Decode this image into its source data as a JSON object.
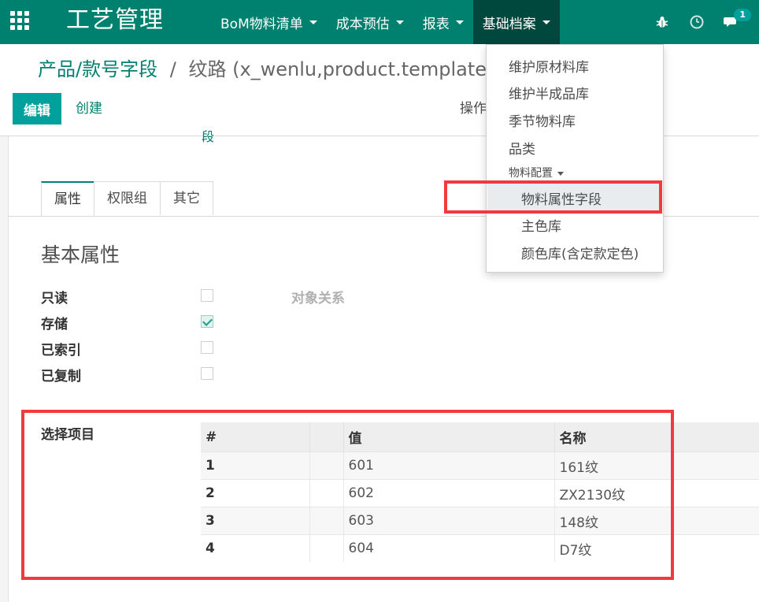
{
  "navbar": {
    "brand": "工艺管理",
    "menus": [
      {
        "label": "BoM物料清单"
      },
      {
        "label": "成本预估"
      },
      {
        "label": "报表"
      },
      {
        "label": "基础档案"
      }
    ],
    "chat_badge": "1",
    "colors": {
      "navbar": "#00806f",
      "active_menu": "#00473e",
      "accent": "#00a09d",
      "annotation": "#f03a40"
    }
  },
  "breadcrumb": {
    "parent": "产品/款号字段",
    "separator": "/",
    "current": "纹路 (x_wenlu,product.template)"
  },
  "toolbar": {
    "edit_label": "编辑",
    "create_label": "创建",
    "actions_label": "操作"
  },
  "form": {
    "cut_text": "段",
    "tabs": [
      {
        "label": "属性",
        "active": true
      },
      {
        "label": "权限组",
        "active": false
      },
      {
        "label": "其它",
        "active": false
      }
    ],
    "group_title": "基本属性",
    "fields": [
      {
        "label": "只读",
        "checked": false
      },
      {
        "label": "存储",
        "checked": true
      },
      {
        "label": "已索引",
        "checked": false
      },
      {
        "label": "已复制",
        "checked": false
      }
    ],
    "relation_label": "对象关系",
    "selection": {
      "label": "选择项目",
      "headers": [
        "#",
        "",
        "值",
        "名称"
      ],
      "rows": [
        [
          "1",
          "",
          "601",
          "161纹"
        ],
        [
          "2",
          "",
          "602",
          "ZX2130纹"
        ],
        [
          "3",
          "",
          "603",
          "148纹"
        ],
        [
          "4",
          "",
          "604",
          "D7纹"
        ]
      ]
    }
  },
  "dropdown": {
    "items": [
      {
        "label": "维护原材料库"
      },
      {
        "label": "维护半成品库"
      },
      {
        "label": "季节物料库"
      },
      {
        "label": "品类"
      }
    ],
    "section_header": "物料配置",
    "sub_items": [
      {
        "label": "物料属性字段",
        "highlighted": true
      },
      {
        "label": "主色库"
      },
      {
        "label": "颜色库(含定款定色)"
      }
    ]
  }
}
